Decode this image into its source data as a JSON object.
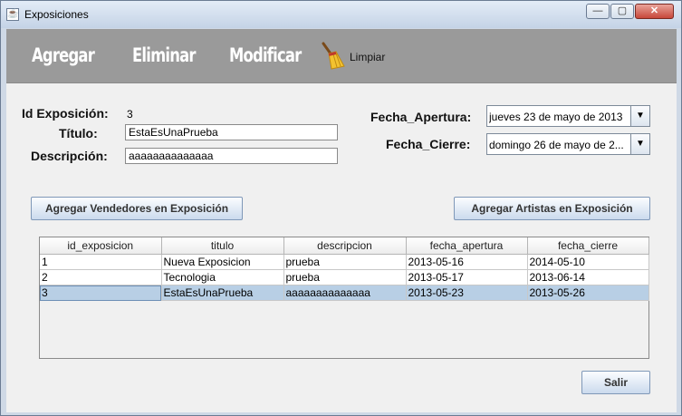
{
  "window": {
    "title": "Exposiciones",
    "app_icon": "java-cup-icon",
    "controls": {
      "minimize": "—",
      "maximize": "▢",
      "close": "✕"
    }
  },
  "toolbar": {
    "agregar": "Agregar",
    "eliminar": "Eliminar",
    "modificar": "Modificar",
    "limpiar": "Limpiar",
    "limpiar_icon": "broom-icon"
  },
  "form": {
    "id_label": "Id Exposición:",
    "id_value": "3",
    "titulo_label": "Título:",
    "titulo_value": "EstaEsUnaPrueba",
    "descripcion_label": "Descripción:",
    "descripcion_value": "aaaaaaaaaaaaaa",
    "fecha_apertura_label": "Fecha_Apertura:",
    "fecha_apertura_value": "jueves 23 de mayo de 2013",
    "fecha_cierre_label": "Fecha_Cierre:",
    "fecha_cierre_value": "domingo 26 de mayo de 2..."
  },
  "buttons": {
    "agregar_vendedores": "Agregar Vendedores en Exposición",
    "agregar_artistas": "Agregar Artistas en Exposición",
    "salir": "Salir"
  },
  "table": {
    "columns": [
      "id_exposicion",
      "titulo",
      "descripcion",
      "fecha_apertura",
      "fecha_cierre"
    ],
    "rows": [
      [
        "1",
        "Nueva Exposicion",
        "prueba",
        "2013-05-16",
        "2014-05-10"
      ],
      [
        "2",
        "Tecnologia",
        "prueba",
        "2013-05-17",
        "2013-06-14"
      ],
      [
        "3",
        "EstaEsUnaPrueba",
        "aaaaaaaaaaaaaa",
        "2013-05-23",
        "2013-05-26"
      ]
    ],
    "selected_row": 2
  },
  "colors": {
    "toolbar_bg": "#9a9a9a",
    "selection": "#b8cfe5",
    "close_button": "#c7473a"
  }
}
